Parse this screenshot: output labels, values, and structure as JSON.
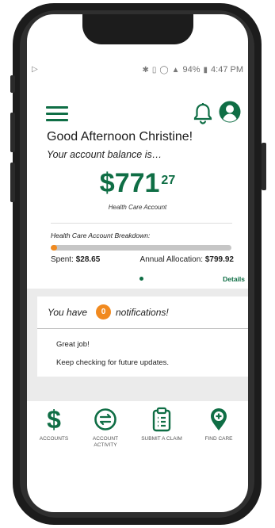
{
  "status_bar": {
    "left_icon": "play-icon",
    "battery": "94%",
    "time": "4:47 PM"
  },
  "header": {
    "menu_icon": "hamburger-icon",
    "bell_icon": "bell-icon",
    "profile_icon": "profile-icon"
  },
  "greeting": "Good Afternoon Christine!",
  "balance_label": "Your account balance is…",
  "balance": {
    "dollars": "$771",
    "cents": "27"
  },
  "account_type": "Health Care Account",
  "breakdown": {
    "title": "Health Care Account Breakdown:",
    "spent_label": "Spent:",
    "spent_value": "$28.65",
    "allocation_label": "Annual Allocation:",
    "allocation_value": "$799.92",
    "progress_fraction": 0.036
  },
  "details_link": "Details",
  "notifications": {
    "prefix": "You have",
    "count": "0",
    "suffix": "notifications!",
    "line1": "Great job!",
    "line2": "Keep checking for future updates."
  },
  "nav": [
    {
      "label": "ACCOUNTS",
      "icon": "dollar-icon"
    },
    {
      "label": "ACCOUNT\nACTIVITY",
      "icon": "swap-arrows-icon"
    },
    {
      "label": "SUBMIT A CLAIM",
      "icon": "clipboard-icon"
    },
    {
      "label": "FIND CARE",
      "icon": "map-pin-plus-icon"
    }
  ],
  "colors": {
    "brand_green": "#0f6e45",
    "accent_orange": "#f18a1f",
    "progress_track": "#c6c6c6",
    "background_gray": "#ebebeb"
  }
}
